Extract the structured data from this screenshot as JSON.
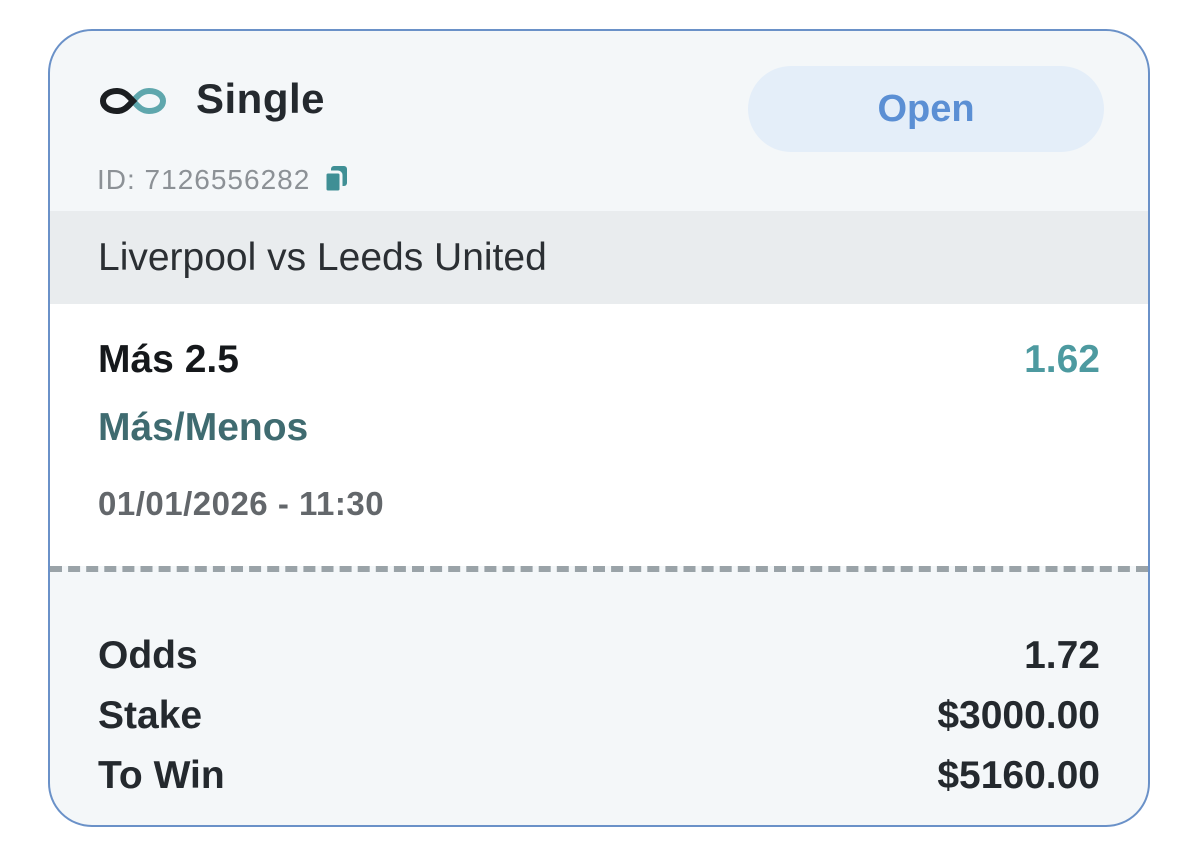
{
  "bet": {
    "type_label": "Single",
    "type_icon": "infinity-link-icon",
    "status": "Open",
    "id_text": "ID: 7126556282",
    "copy_icon": "copy-icon"
  },
  "event": {
    "title": "Liverpool vs Leeds United"
  },
  "selection": {
    "pick": "Más 2.5",
    "odds": "1.62",
    "market": "Más/Menos",
    "datetime": "01/01/2026 - 11:30"
  },
  "summary": {
    "odds_label": "Odds",
    "odds_value": "1.72",
    "stake_label": "Stake",
    "stake_value": "$3000.00",
    "to_win_label": "To Win",
    "to_win_value": "$5160.00"
  },
  "colors": {
    "border": "#6a91c8",
    "status_text": "#5b8fd4",
    "status_bg": "#e4eef9",
    "odds_accent": "#4d9aa0",
    "market_text": "#3f6b70"
  }
}
